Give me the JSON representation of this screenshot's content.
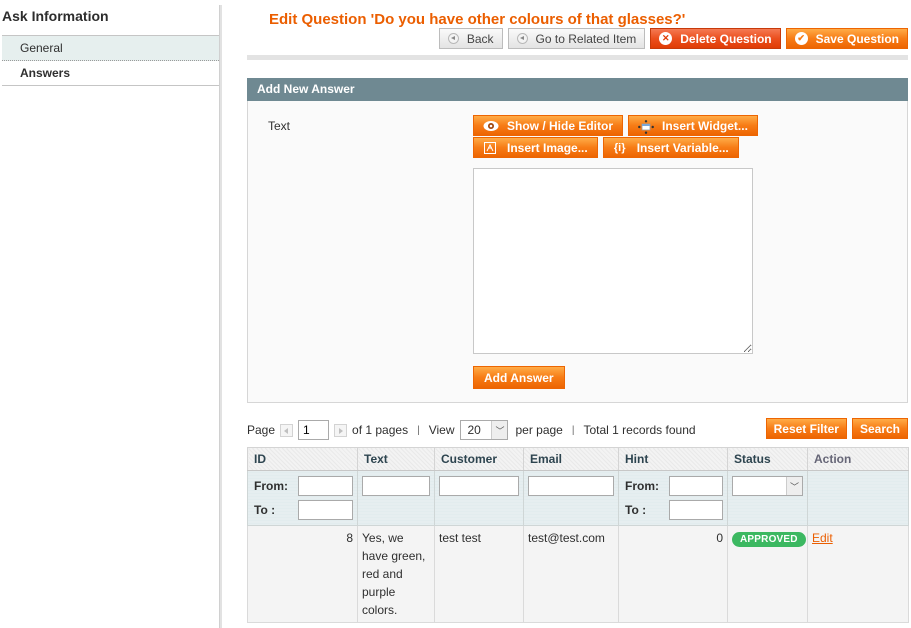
{
  "sidebar": {
    "title": "Ask Information",
    "tabs": [
      {
        "label": "General",
        "active": false
      },
      {
        "label": "Answers",
        "active": true
      }
    ]
  },
  "header": {
    "title": "Edit Question 'Do you have other colours of that glasses?'",
    "buttons": {
      "back": "Back",
      "related": "Go to Related Item",
      "delete": "Delete Question",
      "save": "Save Question"
    }
  },
  "add_answer": {
    "panel_title": "Add New Answer",
    "field_label": "Text",
    "editor_buttons": {
      "show_hide": "Show / Hide Editor",
      "insert_widget": "Insert Widget...",
      "insert_image": "Insert Image...",
      "insert_variable": "Insert Variable..."
    },
    "text_value": "",
    "submit_label": "Add Answer"
  },
  "pager": {
    "page_label": "Page",
    "page_value": "1",
    "of_pages": "of 1 pages",
    "view_label": "View",
    "per_page": "20",
    "per_page_label": "per page",
    "total": "Total 1 records found",
    "reset_filter": "Reset Filter",
    "search": "Search"
  },
  "grid": {
    "columns": [
      "ID",
      "Text",
      "Customer",
      "Email",
      "Hint",
      "Status",
      "Action"
    ],
    "filter": {
      "from_label": "From:",
      "to_label": "To :",
      "status_selected": ""
    },
    "rows": [
      {
        "id": "8",
        "text": "Yes, we have green, red and purple colors.",
        "customer": "test test",
        "email": "test@test.com",
        "hint": "0",
        "status": "APPROVED",
        "action": "Edit"
      }
    ]
  },
  "colors": {
    "accent": "#eb5e00",
    "panel_header": "#6f8992",
    "status_approved": "#3cb861"
  }
}
